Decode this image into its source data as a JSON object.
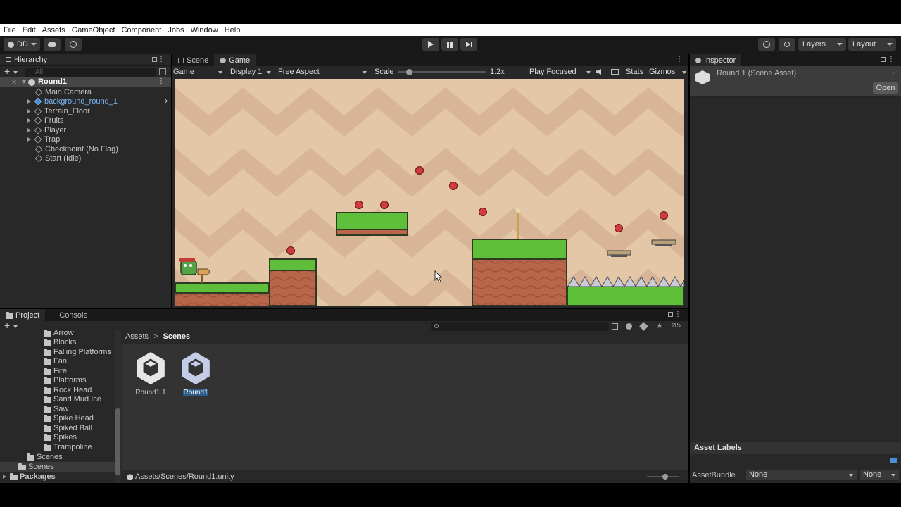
{
  "menu": [
    "File",
    "Edit",
    "Assets",
    "GameObject",
    "Component",
    "Jobs",
    "Window",
    "Help"
  ],
  "toolbar": {
    "account_label": "DD",
    "layers_label": "Layers",
    "layout_label": "Layout"
  },
  "hierarchy": {
    "tab_label": "Hierarchy",
    "search_placeholder": "All",
    "scene_name": "Round1",
    "items": [
      {
        "label": "Main Camera",
        "expandable": false,
        "prefab": false
      },
      {
        "label": "background_round_1",
        "expandable": true,
        "prefab": true
      },
      {
        "label": "Terrain_Floor",
        "expandable": true,
        "prefab": false
      },
      {
        "label": "Fruits",
        "expandable": true,
        "prefab": false
      },
      {
        "label": "Player",
        "expandable": true,
        "prefab": false
      },
      {
        "label": "Trap",
        "expandable": true,
        "prefab": false
      },
      {
        "label": "Checkpoint (No Flag)",
        "expandable": false,
        "prefab": false
      },
      {
        "label": "Start (Idle)",
        "expandable": false,
        "prefab": false
      }
    ]
  },
  "game_view": {
    "tabs": [
      "Scene",
      "Game"
    ],
    "mode": "Game",
    "display": "Display 1",
    "aspect": "Free Aspect",
    "scale_label": "Scale",
    "scale_value": "1.2x",
    "play_focused": "Play Focused",
    "stats": "Stats",
    "gizmos": "Gizmos"
  },
  "inspector": {
    "tab_label": "Inspector",
    "title": "Round 1 (Scene Asset)",
    "open_button": "Open",
    "asset_labels": "Asset Labels",
    "asset_bundle_label": "AssetBundle",
    "asset_bundle_value": "None",
    "asset_variant_value": "None"
  },
  "project": {
    "tabs": [
      "Project",
      "Console"
    ],
    "hidden_count": "5",
    "folders": [
      "Arrow",
      "Blocks",
      "Falling Platforms",
      "Fan",
      "Fire",
      "Platforms",
      "Rock Head",
      "Sand Mud Ice",
      "Saw",
      "Spike Head",
      "Spiked Ball",
      "Spikes",
      "Trampoline"
    ],
    "scenes_sub": "Scenes",
    "scenes_root": "Scenes",
    "packages": "Packages",
    "breadcrumb": [
      "Assets",
      "Scenes"
    ],
    "assets": [
      {
        "name": "Round1.1",
        "selected": false
      },
      {
        "name": "Round1",
        "selected": true
      }
    ],
    "path": "Assets/Scenes/Round1.unity"
  },
  "colors": {
    "accent": "#2c5d87",
    "sky": "#e3c7a6",
    "grass": "#5fbf3a",
    "dirt": "#b8654a"
  }
}
